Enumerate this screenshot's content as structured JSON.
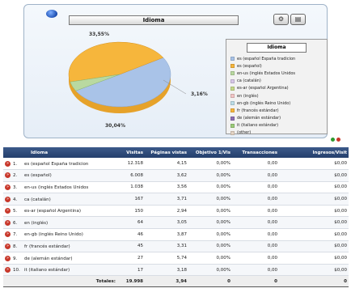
{
  "chart": {
    "title": "Idioma",
    "legend_title": "Idioma",
    "labels": {
      "main": "33,55%",
      "second": "30,04%",
      "small": "3,16%"
    },
    "colors": {
      "main_slice": "#a9c3e8",
      "second_slice": "#f6b63c",
      "header_bg": "#2f4d7c"
    },
    "legend_items": [
      {
        "label": "es (español España tradicion",
        "color": "#a9c3e8"
      },
      {
        "label": "es (español)",
        "color": "#f6b63c"
      },
      {
        "label": "en-us (inglés Estados Unidos",
        "color": "#b9d9a0"
      },
      {
        "label": "ca (catalán)",
        "color": "#d8c8e8"
      },
      {
        "label": "es-ar (español Argentina)",
        "color": "#c6d98a"
      },
      {
        "label": "en (inglés)",
        "color": "#f3c6c6"
      },
      {
        "label": "en-gb (inglés Reino Unido)",
        "color": "#bcdde8"
      },
      {
        "label": "fr (francés estándar)",
        "color": "#f6b63c"
      },
      {
        "label": "de (alemán estándar)",
        "color": "#8c6fb3"
      },
      {
        "label": "it (italiano estándar)",
        "color": "#9ccc7a"
      },
      {
        "label": "(other)",
        "color": "#e3d3c3"
      }
    ]
  },
  "chart_data": {
    "type": "pie",
    "title": "Idioma",
    "slices": [
      {
        "label": "es (español España tradicion",
        "value": 33.55
      },
      {
        "label": "es (español)",
        "value": 30.04
      },
      {
        "label": "en-us (inglés Estados Unidos",
        "value": 3.16
      }
    ]
  },
  "table": {
    "headers": [
      "Idioma",
      "Visitas",
      "Páginas vistas",
      "Objetivo 1/Vis",
      "Transacciones",
      "Ingresos/Visit"
    ],
    "rows": [
      {
        "n": "1.",
        "idioma": "es (español España tradicion",
        "visitas": "12.318",
        "paginas": "4,15",
        "objetivo": "0,00%",
        "trans": "0,00",
        "ingresos": "$0,00"
      },
      {
        "n": "2.",
        "idioma": "es (español)",
        "visitas": "6.008",
        "paginas": "3,62",
        "objetivo": "0,00%",
        "trans": "0,00",
        "ingresos": "$0,00"
      },
      {
        "n": "3.",
        "idioma": "en-us (inglés Estados Unidos",
        "visitas": "1.038",
        "paginas": "3,56",
        "objetivo": "0,00%",
        "trans": "0,00",
        "ingresos": "$0,00"
      },
      {
        "n": "4.",
        "idioma": "ca (catalán)",
        "visitas": "167",
        "paginas": "3,71",
        "objetivo": "0,00%",
        "trans": "0,00",
        "ingresos": "$0,00"
      },
      {
        "n": "5.",
        "idioma": "es-ar (español Argentina)",
        "visitas": "150",
        "paginas": "2,94",
        "objetivo": "0,00%",
        "trans": "0,00",
        "ingresos": "$0,00"
      },
      {
        "n": "6.",
        "idioma": "en (inglés)",
        "visitas": "64",
        "paginas": "3,05",
        "objetivo": "0,00%",
        "trans": "0,00",
        "ingresos": "$0,00"
      },
      {
        "n": "7.",
        "idioma": "en-gb (inglés Reino Unido)",
        "visitas": "46",
        "paginas": "3,87",
        "objetivo": "0,00%",
        "trans": "0,00",
        "ingresos": "$0,00"
      },
      {
        "n": "8.",
        "idioma": "fr (francés estándar)",
        "visitas": "45",
        "paginas": "3,31",
        "objetivo": "0,00%",
        "trans": "0,00",
        "ingresos": "$0,00"
      },
      {
        "n": "9.",
        "idioma": "de (alemán estándar)",
        "visitas": "27",
        "paginas": "5,74",
        "objetivo": "0,00%",
        "trans": "0,00",
        "ingresos": "$0,00"
      },
      {
        "n": "10.",
        "idioma": "it (italiano estándar)",
        "visitas": "17",
        "paginas": "3,18",
        "objetivo": "0,00%",
        "trans": "0,00",
        "ingresos": "$0,00"
      }
    ],
    "totals": {
      "label": "Totales:",
      "visitas": "19.998",
      "paginas": "3,94",
      "objetivo": "0",
      "trans": "0",
      "ingresos": "0"
    }
  }
}
